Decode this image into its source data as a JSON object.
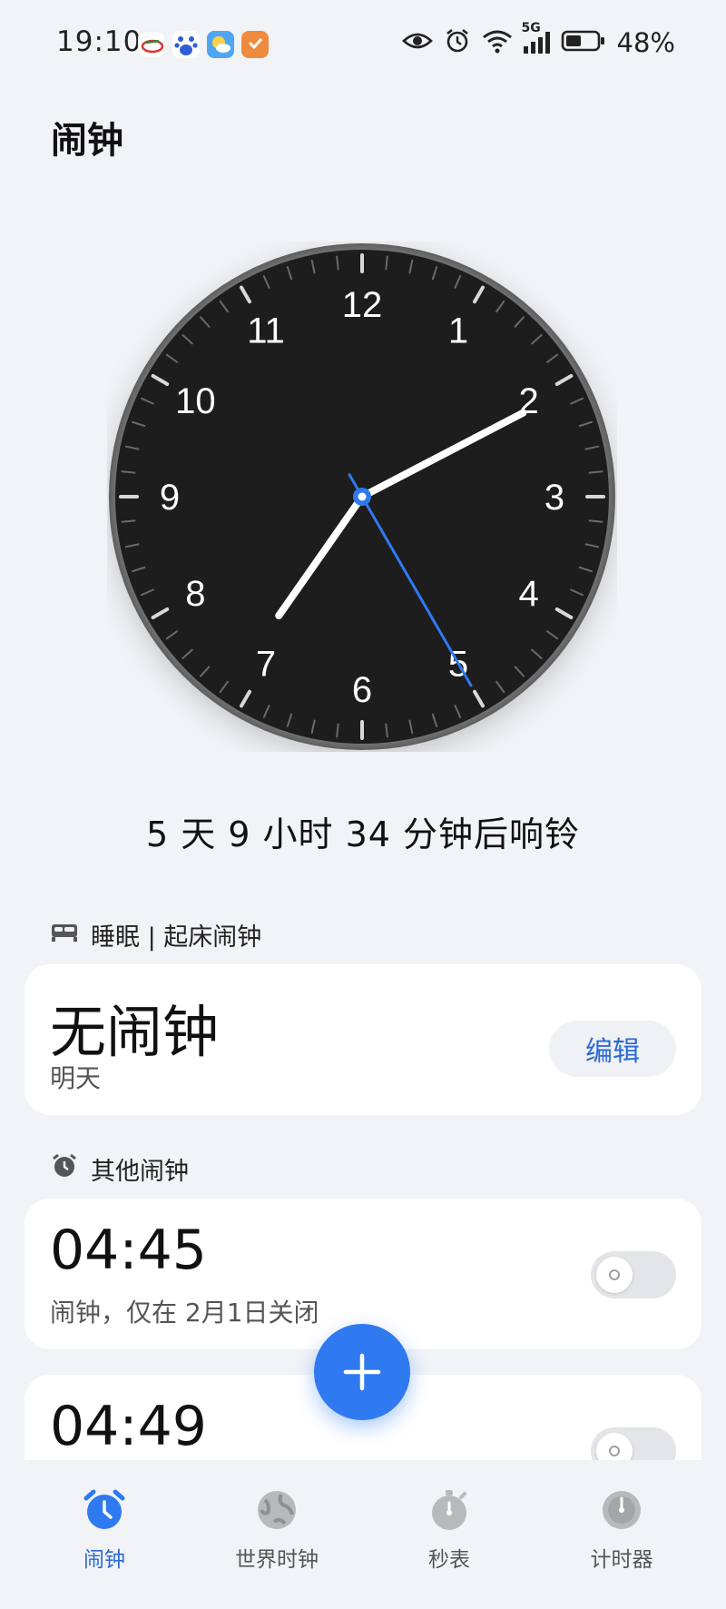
{
  "status_bar": {
    "time": "19:10",
    "battery": "48%",
    "network": "5G"
  },
  "page_title": "闹钟",
  "clock": {
    "numbers": [
      "12",
      "1",
      "2",
      "3",
      "4",
      "5",
      "6",
      "7",
      "8",
      "9",
      "10",
      "11"
    ],
    "hour": 7,
    "minute": 10,
    "second": 25,
    "accent_color": "#2f7af0"
  },
  "countdown": "5 天 9 小时 34 分钟后响铃",
  "sleep_section": {
    "title": "睡眠 | 起床闹钟",
    "main": "无闹钟",
    "sub": "明天",
    "edit_label": "编辑"
  },
  "other_section": {
    "title": "其他闹钟",
    "alarms": [
      {
        "time": "04:45",
        "desc": "闹钟，仅在 2月1日关闭",
        "enabled": false
      },
      {
        "time": "04:49",
        "desc": "",
        "enabled": false
      }
    ]
  },
  "nav": {
    "items": [
      {
        "label": "闹钟",
        "icon": "alarm-icon",
        "active": true
      },
      {
        "label": "世界时钟",
        "icon": "globe-icon",
        "active": false
      },
      {
        "label": "秒表",
        "icon": "stopwatch-icon",
        "active": false
      },
      {
        "label": "计时器",
        "icon": "timer-icon",
        "active": false
      }
    ]
  },
  "colors": {
    "accent": "#2f7af0",
    "background": "#f1f3f6"
  }
}
